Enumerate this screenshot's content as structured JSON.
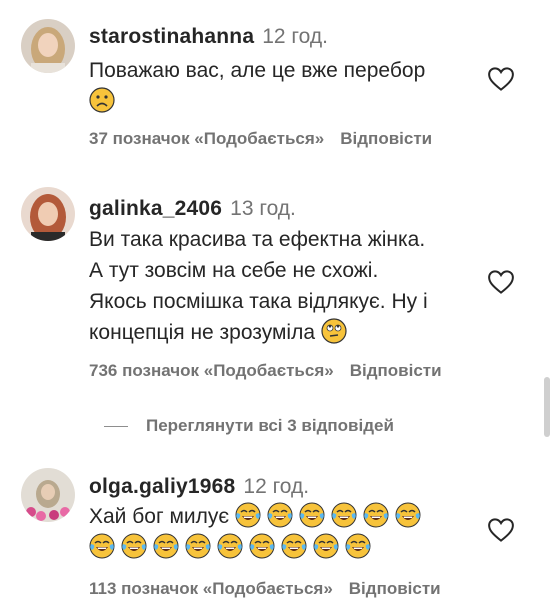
{
  "comments": [
    {
      "username": "starostinahanna",
      "time": "12 год.",
      "text_lines": [
        "Поважаю вас, але це вже перебор"
      ],
      "emoji_line": [
        "frowning-face"
      ],
      "likes": "37 позначок «Подобається»",
      "reply": "Відповісти"
    },
    {
      "username": "galinka_2406",
      "time": "13 год.",
      "text_lines": [
        "Ви така красива та ефектна жінка.",
        "А тут зовсім на себе не схожі.",
        "Якось посмішка така відлякує. Ну і",
        "концепція не зрозуміла"
      ],
      "trailing_emoji": "rolling-eyes-face",
      "likes": "736 позначок «Подобається»",
      "reply": "Відповісти"
    },
    {
      "username": "olga.galiy1968",
      "time": "12 год.",
      "text_lines": [
        "Хай бог милує"
      ],
      "emoji_row1_count": 6,
      "emoji_row2_count": 9,
      "emoji": "face-with-tears-of-joy",
      "likes": "113 позначок «Подобається»",
      "reply": "Відповісти"
    }
  ],
  "view_replies": "Переглянути всі 3 відповідей",
  "colors": {
    "text": "#262626",
    "secondary": "#737373",
    "emoji": "#f7c33b"
  }
}
